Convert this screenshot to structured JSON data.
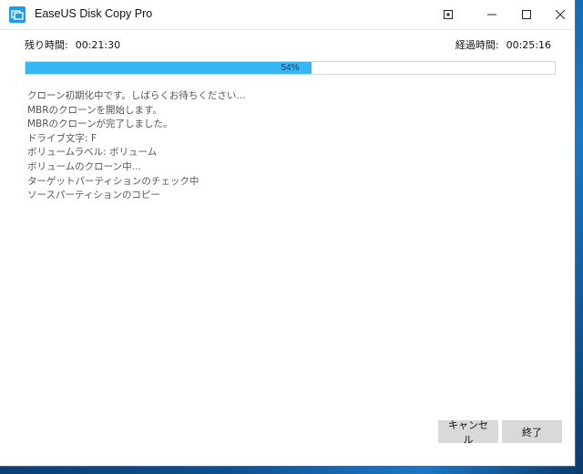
{
  "window": {
    "title": "EaseUS Disk Copy Pro"
  },
  "time": {
    "remaining_label": "残り時間:",
    "remaining_value": "00:21:30",
    "elapsed_label": "経過時間:",
    "elapsed_value": "00:25:16"
  },
  "progress": {
    "percent": 54,
    "text": "54%",
    "fill_color": "#36b6f5"
  },
  "log": [
    "クローン初期化中です。しばらくお待ちください...",
    "MBRのクローンを開始します。",
    "MBRのクローンが完了しました。",
    "ドライブ文字: F",
    "ボリュームラベル: ボリューム",
    "ボリュームのクローン中...",
    "ターゲットパーティションのチェック中",
    "ソースパーティションのコピー"
  ],
  "buttons": {
    "cancel_label": "キャンセル",
    "finish_label": "終了"
  },
  "icons": {
    "app": "disk-copy-app-icon",
    "pin": "pin-icon",
    "minimize": "minimize-icon",
    "maximize": "maximize-icon",
    "close": "close-icon"
  }
}
